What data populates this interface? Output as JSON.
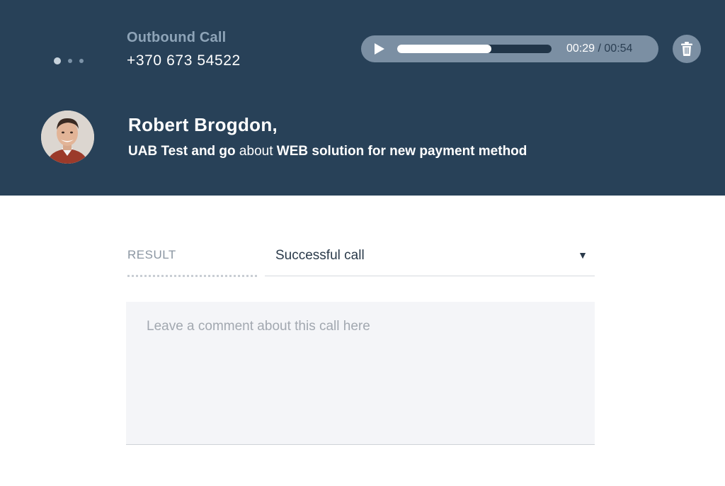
{
  "header": {
    "call_type": "Outbound Call",
    "phone": "+370 673 54522",
    "pager": {
      "count": 3,
      "active_index": 0
    }
  },
  "player": {
    "current_time": "00:29",
    "separator": "/",
    "total_time": "00:54",
    "progress_fraction": 0.61,
    "play_icon": "play-icon",
    "delete_icon": "trash-icon"
  },
  "contact": {
    "name": "Robert Brogdon,",
    "company": "UAB Test and go",
    "about_word": " about ",
    "topic": "WEB solution for new payment method"
  },
  "form": {
    "result_label": "RESULT",
    "result_value": "Successful call",
    "comment_value": "",
    "comment_placeholder": "Leave a comment about this call here"
  },
  "colors": {
    "header_bg": "#284158",
    "player_bg": "#7b8fa3",
    "comment_bg": "#f4f5f8"
  }
}
